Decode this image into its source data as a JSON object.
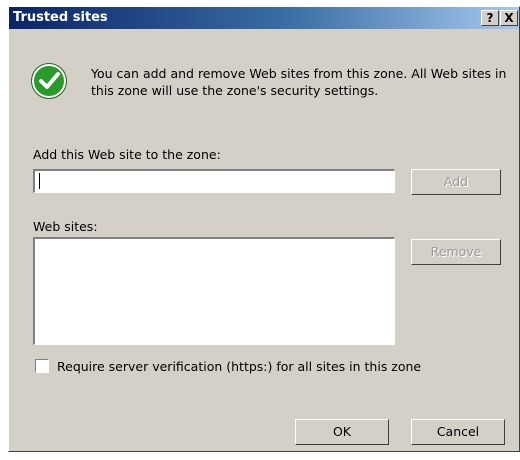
{
  "dialog": {
    "title": "Trusted sites",
    "help_glyph": "?",
    "close_glyph": "X"
  },
  "info": {
    "icon": "green-check-icon",
    "message": "You can add and remove Web sites from this zone. All Web sites in this zone will use the zone's security settings."
  },
  "add_site": {
    "label": "Add this Web site to the zone:",
    "value": "",
    "button_label": "Add",
    "button_enabled": false
  },
  "web_sites": {
    "label": "Web sites:",
    "items": [],
    "remove_label": "Remove",
    "remove_enabled": false
  },
  "https_check": {
    "label": "Require server verification (https:) for all sites in this zone",
    "checked": false
  },
  "footer": {
    "ok_label": "OK",
    "cancel_label": "Cancel"
  },
  "colors": {
    "title_gradient_start": "#0a246a",
    "title_gradient_end": "#a6caf0",
    "dialog_face": "#d4d0c8",
    "check_green": "#2a9a2a"
  }
}
